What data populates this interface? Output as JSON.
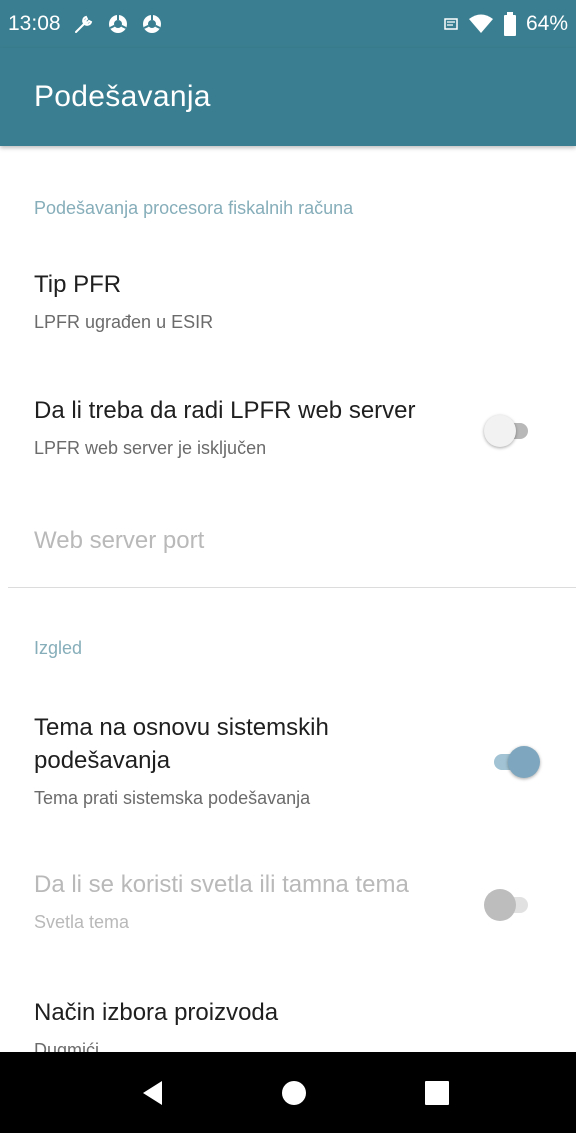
{
  "status_bar": {
    "time": "13:08",
    "battery": "64%",
    "icons_left": [
      "wrench-icon",
      "chrome-icon",
      "chrome-icon"
    ],
    "icons_right": [
      "notification-icon",
      "wifi-icon",
      "battery-icon"
    ]
  },
  "app_bar": {
    "title": "Podešavanja"
  },
  "colors": {
    "primary": "#3a7f91",
    "category_text": "#86aeba",
    "switch_on": "#7ea7bf"
  },
  "sections": {
    "pfr": {
      "header": "Podešavanja procesora fiskalnih računa",
      "tip_pfr": {
        "title": "Tip PFR",
        "summary": "LPFR ugrađen u ESIR"
      },
      "web_server": {
        "title": "Da li treba da radi LPFR web server",
        "summary": "LPFR web server je isključen",
        "checked": false
      },
      "web_server_port": {
        "title": "Web server port",
        "enabled": false
      }
    },
    "izgled": {
      "header": "Izgled",
      "system_theme": {
        "title_line1": "Tema na osnovu sistemskih",
        "title_line2": "podešavanja",
        "summary": "Tema prati sistemska podešavanja",
        "checked": true
      },
      "light_dark": {
        "title": "Da li se koristi svetla ili tamna tema",
        "summary": "Svetla tema",
        "checked": false,
        "enabled": false
      },
      "product_selection": {
        "title": "Način izbora proizvoda",
        "summary": "Dugmići"
      }
    }
  },
  "nav_bar": {
    "buttons": [
      "back-icon",
      "home-icon",
      "recents-icon"
    ]
  }
}
